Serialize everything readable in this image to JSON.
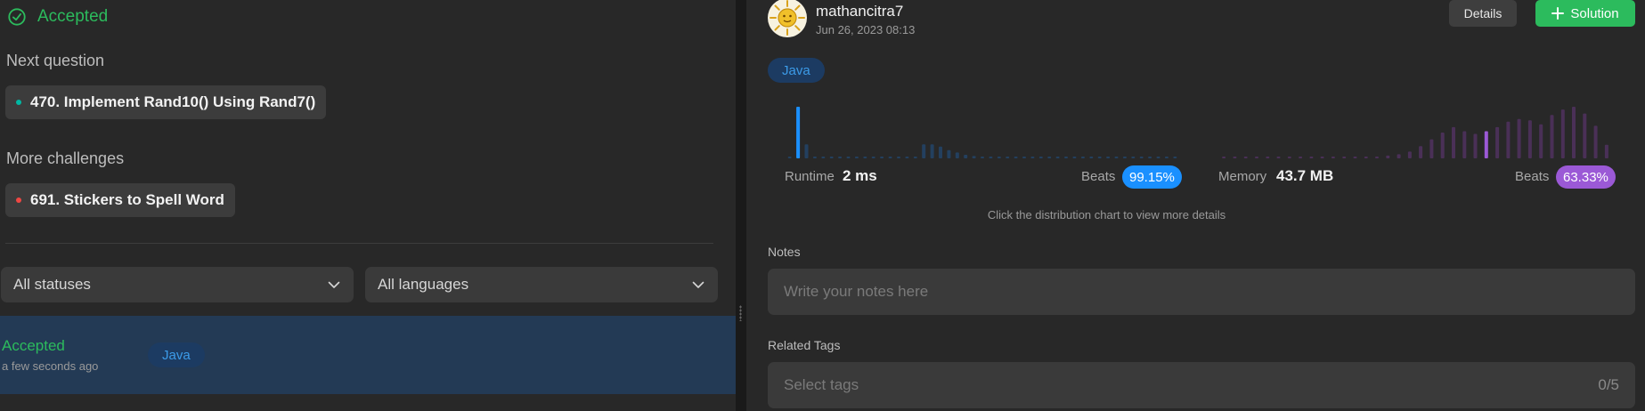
{
  "left": {
    "status_title": "Accepted",
    "next_question": {
      "label": "Next question",
      "item": "470. Implement Rand10() Using Rand7()",
      "dot_color": "#00b8a3"
    },
    "more_challenges": {
      "label": "More challenges",
      "item": "691. Stickers to Spell Word",
      "dot_color": "#ef4743"
    },
    "filters": {
      "status": "All statuses",
      "language": "All languages"
    },
    "submission": {
      "status": "Accepted",
      "time": "a few seconds ago",
      "language": "Java"
    }
  },
  "right": {
    "user": {
      "name": "mathancitra7",
      "date": "Jun 26, 2023 08:13"
    },
    "buttons": {
      "details": "Details",
      "solution": "Solution"
    },
    "language": "Java",
    "runtime": {
      "label": "Runtime",
      "value": "2 ms",
      "beats_label": "Beats",
      "beats": "99.15%",
      "color": "#1a90ff",
      "distribution": [
        1,
        44,
        12,
        1,
        1,
        1,
        1,
        1,
        1,
        1,
        1,
        1,
        1,
        1,
        1,
        1,
        12,
        12,
        10,
        7,
        5,
        3,
        2,
        1,
        1,
        1,
        1,
        1,
        1,
        1,
        1,
        1,
        1,
        1,
        1,
        1,
        1,
        1,
        1,
        1,
        1,
        1,
        1,
        1,
        1,
        1,
        1
      ],
      "highlight_index": 1
    },
    "memory": {
      "label": "Memory",
      "value": "43.7 MB",
      "beats_label": "Beats",
      "beats": "63.33%",
      "color": "#9b59d6",
      "distribution": [
        1,
        1,
        1,
        1,
        1,
        1,
        1,
        1,
        1,
        1,
        1,
        1,
        1,
        1,
        1,
        2,
        3,
        5,
        9,
        14,
        19,
        23,
        20,
        18,
        20,
        23,
        27,
        29,
        28,
        25,
        32,
        36,
        38,
        33,
        24,
        10
      ],
      "highlight_index": 24
    },
    "hint": "Click the distribution chart to view more details",
    "notes": {
      "label": "Notes",
      "placeholder": "Write your notes here"
    },
    "tags": {
      "label": "Related Tags",
      "placeholder": "Select tags",
      "count": "0/5"
    }
  }
}
